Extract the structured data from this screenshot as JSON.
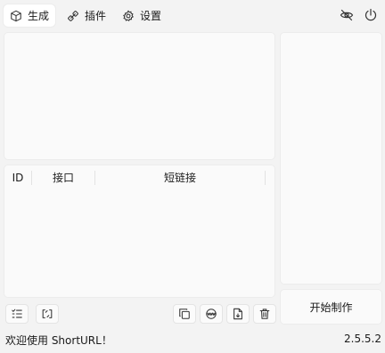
{
  "tabs": [
    {
      "label": "生成",
      "icon": "cube-icon",
      "active": true
    },
    {
      "label": "插件",
      "icon": "plugin-icon",
      "active": false
    },
    {
      "label": "设置",
      "icon": "gear-icon",
      "active": false
    }
  ],
  "table": {
    "columns": [
      "ID",
      "接口",
      "短链接"
    ]
  },
  "actions": {
    "start_label": "开始制作"
  },
  "status": {
    "message": "欢迎使用 ShortURL！",
    "version": "2.5.5.2"
  }
}
